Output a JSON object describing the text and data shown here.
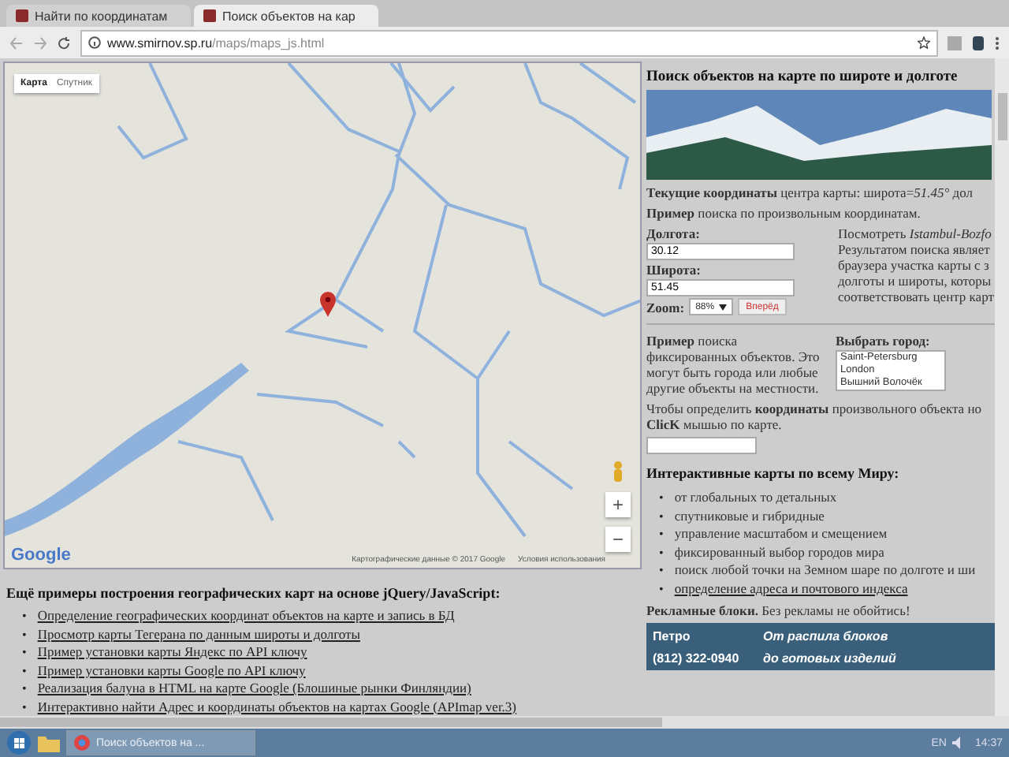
{
  "browser": {
    "tabs": [
      {
        "title": "Найти по координатам",
        "selected": false
      },
      {
        "title": "Поиск объектов на кар",
        "selected": true
      }
    ],
    "url_host": "www.smirnov.sp.ru",
    "url_path": "/maps/maps_js.html"
  },
  "map": {
    "type_buttons": [
      {
        "label": "Карта",
        "selected": true
      },
      {
        "label": "Спутник",
        "selected": false
      }
    ],
    "zoom_in": "+",
    "zoom_out": "−",
    "logo": "Google",
    "attribution": "Картографические данные © 2017 Google",
    "terms": "Условия использования"
  },
  "examples": {
    "bullet": "•",
    "heading": "Ещё примеры построения географических карт на основе jQuery/JavaScript:",
    "links": [
      "Определение географических координат объектов на карте и запись в БД",
      "Просмотр карты Тегерана по данным широты и долготы",
      "Пример установки карты Яндекс по API ключу",
      "Пример установки карты Google по API ключу",
      "Реализация балуна в HTML на карте Google (Блошиные рынки Финляндии)",
      "Интерактивно найти Адрес и координаты объектов на картах Google (APImap ver.3)"
    ]
  },
  "panel": {
    "title": "Поиск объектов на карте по широте и долготе",
    "current": "**Текущие координаты** центра карты: широта=*51.45°* дол",
    "example1": "**Пример** поиска по произвольным координатам.",
    "lon_label": "Долгота:",
    "lon_value": "30.12",
    "lat_label": "Широта:",
    "lat_value": "51.45",
    "zoom_label": "Zoom:",
    "zoom_value": "88%",
    "go_button": "Вперёд",
    "side_lines": [
      "Посмотреть *Istambul-Bozfo*",
      "Результатом поиска являет",
      "браузера участка карты с з",
      "долготы и широты, которы",
      "соответствовать центр карт"
    ],
    "example2": "**Пример** поиска фиксированных объектов. Это могут быть города или любые другие объекты на местности.",
    "city_label": "Выбрать город:",
    "cities": [
      "Saint-Petersburg",
      "London",
      "Вышний Волочёк"
    ],
    "click_lines": [
      "Чтобы определить **координаты** произвольного объекта но",
      "**ClicK** мышью по карте."
    ],
    "world_bullet": "•",
    "world_heading": "Интерактивные карты по всему Миру:",
    "world_items": [
      {
        "text": "от глобальных то детальных",
        "link": false
      },
      {
        "text": "спутниковые и гибридные",
        "link": false
      },
      {
        "text": "управление масштабом и смещением",
        "link": false
      },
      {
        "text": "фиксированный выбор городов мира",
        "link": false
      },
      {
        "text": "поиск любой точки на Земном шаре по долготе и ши",
        "link": false
      },
      {
        "text": "определение адреса и почтового индекса",
        "link": true
      }
    ],
    "ads": "**Рекламные блоки.** Без рекламы не обойтись!",
    "ad_brand": "Петро",
    "ad_phone": "(812) 322-0940",
    "ad_slogan": [
      "От распила блоков",
      "до готовых изделий"
    ]
  },
  "taskbar": {
    "apps": [
      {
        "label": "Поиск объектов на ...",
        "active": true
      }
    ],
    "language": "EN",
    "time": "14:37"
  }
}
